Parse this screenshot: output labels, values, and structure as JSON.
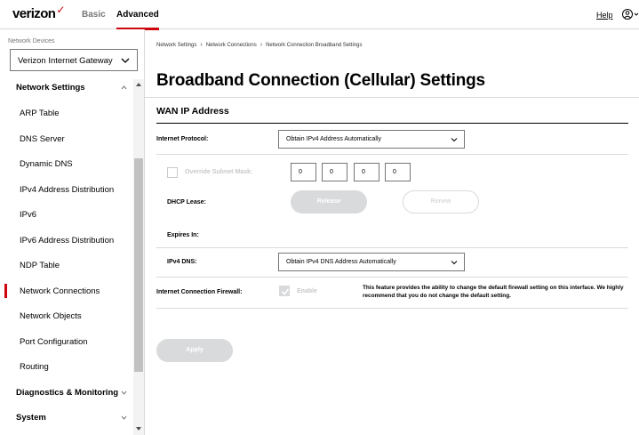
{
  "header": {
    "logo_text": "verizon",
    "logo_mark": "✓",
    "tabs": [
      {
        "label": "Basic",
        "active": false
      },
      {
        "label": "Advanced",
        "active": true
      }
    ],
    "help_label": "Help",
    "user_icon": "user-circle-icon",
    "accent_color": "#cd040b"
  },
  "sidebar": {
    "device_label": "Network Devices",
    "device_value": "Verizon Internet Gateway",
    "sections": {
      "network_settings": "Network Settings",
      "diagnostics": "Diagnostics & Monitoring",
      "system": "System"
    },
    "items": [
      {
        "label": "ARP Table"
      },
      {
        "label": "DNS Server"
      },
      {
        "label": "Dynamic DNS"
      },
      {
        "label": "IPv4 Address Distribution"
      },
      {
        "label": "IPv6"
      },
      {
        "label": "IPv6 Address Distribution"
      },
      {
        "label": "NDP Table"
      },
      {
        "label": "Network Connections",
        "active": true
      },
      {
        "label": "Network Objects"
      },
      {
        "label": "Port Configuration"
      },
      {
        "label": "Routing"
      }
    ]
  },
  "main": {
    "breadcrumb": [
      "Network Settings",
      "Network Connections",
      "Network Connection Broadband Settings"
    ],
    "breadcrumb_sep": "›",
    "title": "Broadband Connection (Cellular) Settings",
    "section_title": "WAN IP Address",
    "internet_protocol_label": "Internet Protocol:",
    "internet_protocol_value": "Obtain IPv4 Address Automatically",
    "override_subnet_label": "Override Subnet Mask:",
    "subnet_octets": [
      "0",
      "0",
      "0",
      "0"
    ],
    "dhcp_lease_label": "DHCP Lease:",
    "release_label": "Release",
    "renew_label": "Renew",
    "expires_label": "Expires In:",
    "ipv4_dns_label": "IPv4 DNS:",
    "ipv4_dns_value": "Obtain IPv4 DNS Address Automatically",
    "firewall_label": "Internet Connection Firewall:",
    "enable_label": "Enable",
    "firewall_description": "This feature provides the ability to change the default firewall setting on this interface. We highly recommend that you do not change the default setting.",
    "apply_label": "Apply"
  }
}
